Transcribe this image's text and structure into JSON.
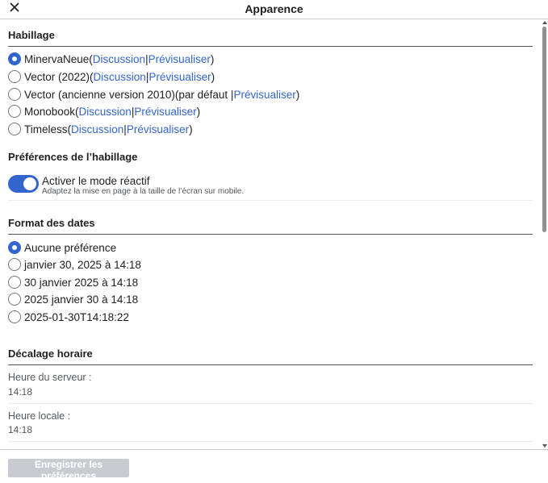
{
  "header": {
    "title": "Apparence",
    "close_icon": "close-icon"
  },
  "skin": {
    "title": "Habillage",
    "options": [
      {
        "name": "MinervaNeue",
        "open": " (",
        "discussion": "Discussion",
        "sep": " | ",
        "preview": "Prévisualiser",
        "close": ")",
        "checked": true
      },
      {
        "name": "Vector (2022)",
        "open": " (",
        "discussion": "Discussion",
        "sep": " | ",
        "preview": "Prévisualiser",
        "close": ")",
        "checked": false
      },
      {
        "name": "Vector (ancienne version 2010)",
        "open": " (par défaut | ",
        "discussion": "",
        "sep": "",
        "preview": "Prévisualiser",
        "close": ")",
        "checked": false
      },
      {
        "name": "Monobook",
        "open": " (",
        "discussion": "Discussion",
        "sep": " | ",
        "preview": "Prévisualiser",
        "close": ")",
        "checked": false
      },
      {
        "name": "Timeless",
        "open": " (",
        "discussion": "Discussion",
        "sep": " | ",
        "preview": "Prévisualiser",
        "close": ")",
        "checked": false
      }
    ]
  },
  "skin_prefs": {
    "title": "Préférences de l’habillage",
    "toggle_label": "Activer le mode réactif",
    "toggle_help": "Adaptez la mise en page à la taille de l’écran sur mobile.",
    "toggle_on": true
  },
  "date_format": {
    "title": "Format des dates",
    "options": [
      {
        "label": "Aucune préférence",
        "checked": true
      },
      {
        "label": "janvier 30, 2025 à 14:18",
        "checked": false
      },
      {
        "label": "30 janvier 2025 à 14:18",
        "checked": false
      },
      {
        "label": "2025 janvier 30 à 14:18",
        "checked": false
      },
      {
        "label": "2025-01-30T14:18:22",
        "checked": false
      }
    ]
  },
  "time_offset": {
    "title": "Décalage horaire",
    "server_label": "Heure du serveur :",
    "server_value": "14:18",
    "local_label": "Heure locale :",
    "local_value": "14:18"
  },
  "footer": {
    "save_label": "Enregistrer les préférences"
  },
  "colors": {
    "accent": "#3366cc",
    "disabled_button": "#c8ccd1"
  }
}
